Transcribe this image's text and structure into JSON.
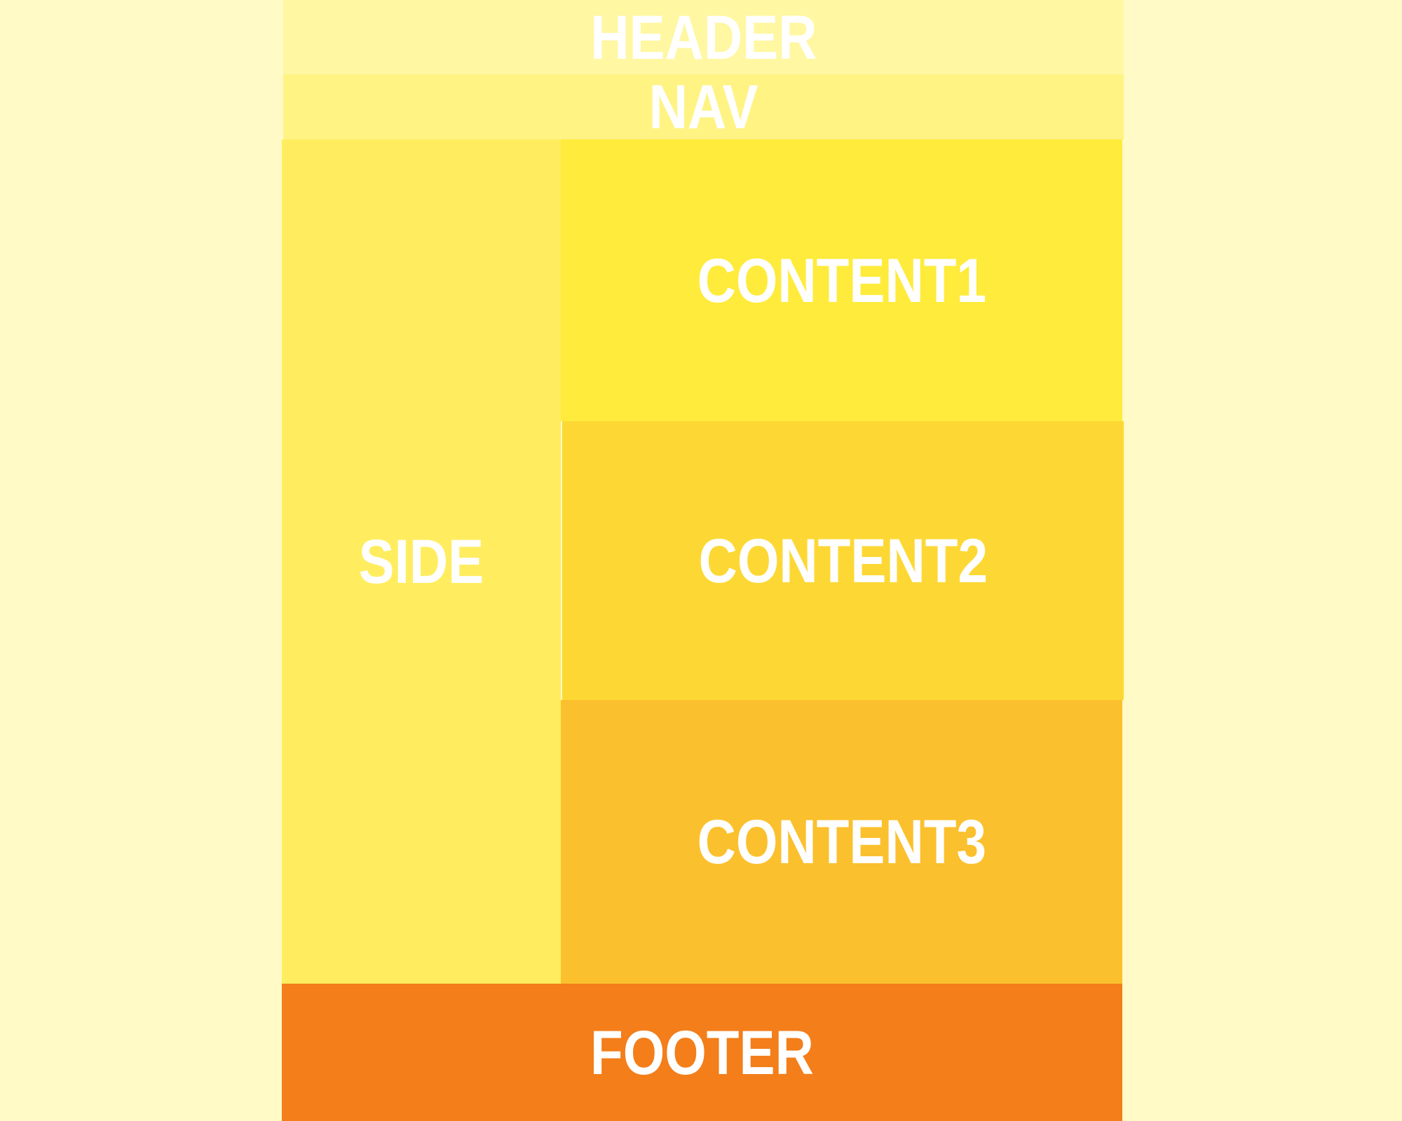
{
  "layout": {
    "header": {
      "label": "HEADER",
      "color": "#fff7a2"
    },
    "nav": {
      "label": "NAV",
      "color": "#fff384"
    },
    "side": {
      "label": "SIDE",
      "color": "#ffed5f"
    },
    "content1": {
      "label": "CONTENT1",
      "color": "#ffeb3b"
    },
    "content2": {
      "label": "CONTENT2",
      "color": "#fdd835"
    },
    "content3": {
      "label": "CONTENT3",
      "color": "#fbc02d"
    },
    "footer": {
      "label": "FOOTER",
      "color": "#f37e1a"
    },
    "page_background": "#fffac6"
  }
}
